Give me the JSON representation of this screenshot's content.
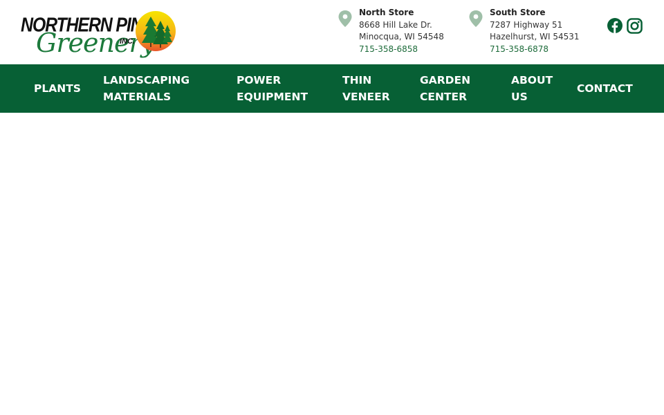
{
  "brand": {
    "line1": "NORTHERN PINES",
    "line2": "Greenery",
    "suffix": "INC."
  },
  "stores": [
    {
      "name": "North Store",
      "address1": "8668 Hill Lake Dr.",
      "address2": "Minocqua, WI 54548",
      "phone": "715-358-6858"
    },
    {
      "name": "South Store",
      "address1": "7287 Highway 51",
      "address2": "Hazelhurst, WI 54531",
      "phone": "715-358-6878"
    }
  ],
  "social": [
    {
      "icon": "facebook-icon"
    },
    {
      "icon": "instagram-icon"
    }
  ],
  "nav": {
    "items": [
      {
        "label": "PLANTS"
      },
      {
        "label": "LANDSCAPING MATERIALS"
      },
      {
        "label": "POWER EQUIPMENT"
      },
      {
        "label": "THIN VENEER"
      },
      {
        "label": "GARDEN CENTER"
      },
      {
        "label": "ABOUT US"
      },
      {
        "label": "CONTACT"
      }
    ]
  },
  "colors": {
    "nav_bg": "#076035",
    "brand_green": "#1d7a3c",
    "pin": "#9fbfa8",
    "phone_link": "#1d6b3a"
  }
}
